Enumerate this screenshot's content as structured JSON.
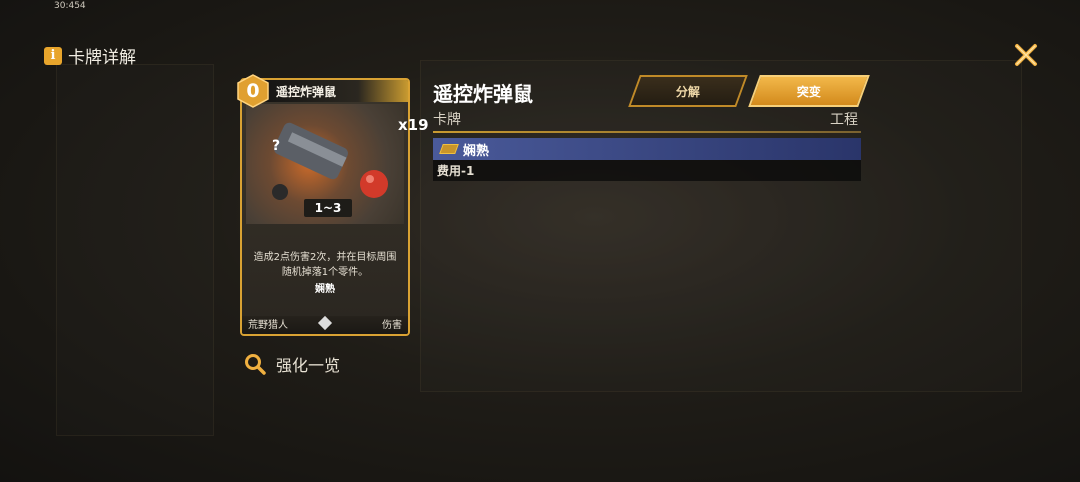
{
  "status": {
    "clock": "30:454"
  },
  "header": {
    "title": "卡牌详解"
  },
  "card": {
    "cost": "0",
    "name": "遥控炸弹鼠",
    "quantity": "x19",
    "range": "1~3",
    "description": "造成2点伤害2次，并在目标周围随机掉落1个零件。",
    "keyword": "娴熟",
    "faction": "荒野猎人",
    "type": "伤害"
  },
  "detail": {
    "name": "遥控炸弹鼠",
    "subtitle": "卡牌",
    "tag": "工程",
    "decompose_label": "分解",
    "breakthrough_label": "突变",
    "keyword": "娴熟",
    "keyword_effect": "费用-1"
  },
  "footer": {
    "upgrade_label": "强化一览"
  },
  "colors": {
    "accent": "#d9a233",
    "keyword_bg": "#4a5a9a",
    "breakthrough": "#f2b84a"
  },
  "icons": [
    "info-icon",
    "close-icon",
    "search-icon",
    "keyword-icon"
  ]
}
